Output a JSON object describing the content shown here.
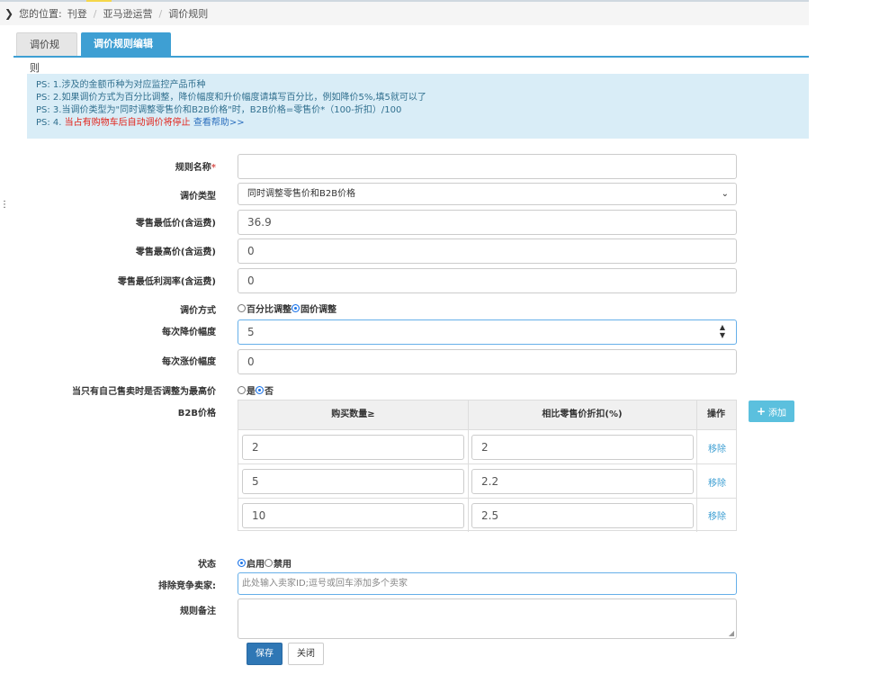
{
  "breadcrumb": {
    "prefix": "您的位置:",
    "items": [
      "刊登",
      "亚马逊运营",
      "调价规则"
    ]
  },
  "tabs": [
    {
      "label": "调价规则"
    },
    {
      "label": "调价规则编辑",
      "close": "✖"
    }
  ],
  "notice": {
    "lines": [
      "PS: 1.涉及的金额币种为对应监控产品币种",
      "PS: 2.如果调价方式为百分比调整，降价幅度和升价幅度请填写百分比，例如降价5%,填5就可以了",
      "PS: 3.当调价类型为\"同时调整零售价和B2B价格\"时，B2B价格=零售价*（100-折扣）/100"
    ],
    "line4_prefix": "PS: 4.",
    "line4_red": "当占有购物车后自动调价将停止",
    "line4_link": "查看帮助>>"
  },
  "form": {
    "rule_name": {
      "label": "规则名称",
      "required": "*",
      "value": ""
    },
    "price_type": {
      "label": "调价类型",
      "value": "同时调整零售价和B2B价格"
    },
    "min_price": {
      "label": "零售最低价(含运费)",
      "value": "36.9"
    },
    "max_price": {
      "label": "零售最高价(含运费)",
      "value": "0"
    },
    "min_margin": {
      "label": "零售最低利润率(含运费)",
      "value": "0"
    },
    "method": {
      "label": "调价方式",
      "options": [
        "百分比调整",
        "固价调整"
      ],
      "selected": 1
    },
    "decrease": {
      "label": "每次降价幅度",
      "value": "5"
    },
    "increase": {
      "label": "每次涨价幅度",
      "value": "0"
    },
    "self_only": {
      "label": "当只有自己售卖时是否调整为最高价",
      "options": [
        "是",
        "否"
      ],
      "selected": 1
    },
    "b2b": {
      "label": "B2B价格",
      "headers": [
        "购买数量≥",
        "相比零售价折扣(%)",
        "操作"
      ],
      "rows": [
        {
          "qty": "2",
          "discount": "2",
          "action": "移除"
        },
        {
          "qty": "5",
          "discount": "2.2",
          "action": "移除"
        },
        {
          "qty": "10",
          "discount": "2.5",
          "action": "移除"
        }
      ],
      "add_label": "添加"
    },
    "status": {
      "label": "状态",
      "options": [
        "启用",
        "禁用"
      ],
      "selected": 0
    },
    "exclude": {
      "label": "排除竞争卖家:",
      "placeholder": "此处输入卖家ID;逗号或回车添加多个卖家"
    },
    "remark": {
      "label": "规则备注",
      "value": ""
    }
  },
  "buttons": {
    "save": "保存",
    "close": "关闭"
  }
}
